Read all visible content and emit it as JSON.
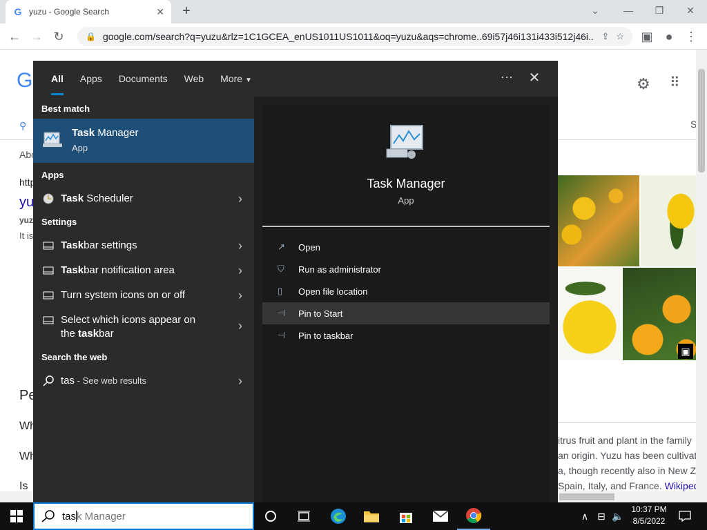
{
  "browser": {
    "tab_title": "yuzu - Google Search",
    "tab_favicon": "G",
    "url": "google.com/search?q=yuzu&rlz=1C1GCEA_enUS1011US1011&oq=yuzu&aqs=chrome..69i57j46i131i433i512j46i..."
  },
  "page": {
    "logo_fragment": "G",
    "about_fragment": "Abo",
    "http_fragment": "http",
    "link_fragment": "yu",
    "bold_fragment": "yuz",
    "it_fragment": "It is",
    "peop_fragment": "Pe",
    "wh1": "Wh",
    "wh2": "Wh",
    "is_fragment": "Is",
    "s_fragment": "S",
    "kp_line1": "itrus fruit and plant in the family",
    "kp_line2": "an origin. Yuzu has been cultivat",
    "kp_line3": "a, though recently also in New Z",
    "kp_line4": "Spain, Italy, and France.",
    "kp_wiki": "Wikiped"
  },
  "start_menu": {
    "tabs": [
      "All",
      "Apps",
      "Documents",
      "Web",
      "More"
    ],
    "best_match_header": "Best match",
    "best_match": {
      "title_bold": "Task",
      "title_rest": " Manager",
      "subtitle": "App"
    },
    "apps_header": "Apps",
    "apps": [
      {
        "bold": "Task",
        "rest": " Scheduler"
      }
    ],
    "settings_header": "Settings",
    "settings": [
      {
        "bold": "Task",
        "rest": "bar settings"
      },
      {
        "bold": "Task",
        "rest": "bar notification area"
      },
      {
        "bold": "",
        "rest": "Turn system icons on or off"
      },
      {
        "pre": "Select which icons appear on the ",
        "bold": "task",
        "rest": "bar"
      }
    ],
    "web_header": "Search the web",
    "web_query": "tas",
    "web_suffix": " - See web results",
    "detail": {
      "title": "Task Manager",
      "subtitle": "App"
    },
    "actions": [
      "Open",
      "Run as administrator",
      "Open file location",
      "Pin to Start",
      "Pin to taskbar"
    ]
  },
  "taskbar": {
    "search_typed": "tas",
    "search_suggest": "k Manager",
    "time": "10:37 PM",
    "date": "8/5/2022"
  }
}
